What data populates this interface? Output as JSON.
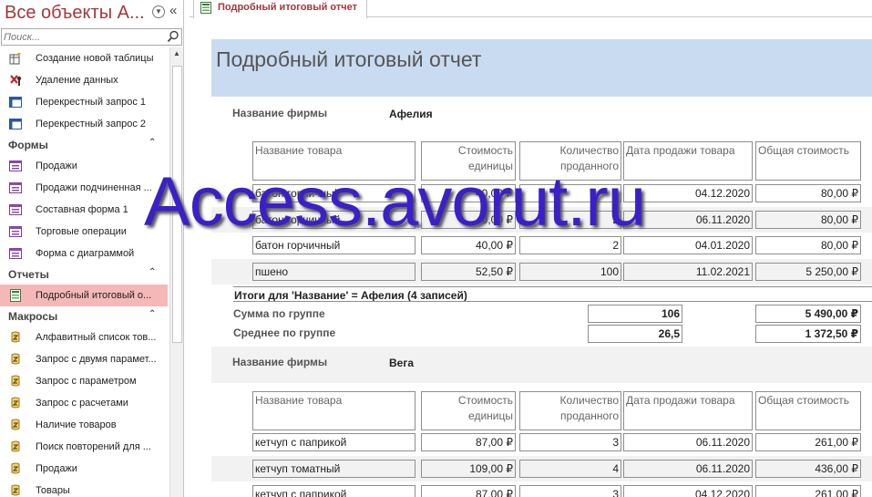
{
  "nav": {
    "title": "Все объекты A...",
    "search_placeholder": "Поиск...",
    "items": [
      {
        "kind": "item",
        "icon": "create-table-query-icon",
        "label": "Создание новой таблицы"
      },
      {
        "kind": "item",
        "icon": "delete-query-icon",
        "label": "Удаление данных"
      },
      {
        "kind": "item",
        "icon": "crosstab-query-icon",
        "label": "Перекрестный запрос 1"
      },
      {
        "kind": "item",
        "icon": "crosstab-query-icon",
        "label": "Перекрестный запрос 2"
      },
      {
        "kind": "group",
        "label": "Формы"
      },
      {
        "kind": "item",
        "icon": "form-icon",
        "label": "Продажи"
      },
      {
        "kind": "item",
        "icon": "form-icon",
        "label": "Продажи подчиненная ..."
      },
      {
        "kind": "item",
        "icon": "form-icon",
        "label": "Составная форма 1"
      },
      {
        "kind": "item",
        "icon": "form-icon",
        "label": "Торговые операции"
      },
      {
        "kind": "item",
        "icon": "form-icon",
        "label": "Форма с диаграммой"
      },
      {
        "kind": "group",
        "label": "Отчеты"
      },
      {
        "kind": "item",
        "icon": "report-icon",
        "label": "Подробный итоговый о...",
        "selected": true
      },
      {
        "kind": "group",
        "label": "Макросы"
      },
      {
        "kind": "item",
        "icon": "macro-icon",
        "label": "Алфавитный список тов..."
      },
      {
        "kind": "item",
        "icon": "macro-icon",
        "label": "Запрос с двумя парамет..."
      },
      {
        "kind": "item",
        "icon": "macro-icon",
        "label": "Запрос с параметром"
      },
      {
        "kind": "item",
        "icon": "macro-icon",
        "label": "Запрос с расчетами"
      },
      {
        "kind": "item",
        "icon": "macro-icon",
        "label": "Наличие товаров"
      },
      {
        "kind": "item",
        "icon": "macro-icon",
        "label": "Поиск повторений для ..."
      },
      {
        "kind": "item",
        "icon": "macro-icon",
        "label": "Продажи"
      },
      {
        "kind": "item",
        "icon": "macro-icon",
        "label": "Товары"
      }
    ]
  },
  "tab": {
    "label": "Подробный итоговый отчет"
  },
  "report": {
    "title": "Подробный итоговый отчет",
    "group_label": "Название фирмы",
    "columns": [
      "Название товара",
      "Стоимость единицы",
      "Количество проданного",
      "Дата продажи товара",
      "Общая стоимость"
    ],
    "groups": [
      {
        "name": "Афелия",
        "rows": [
          [
            "батон горчичный",
            "40,00 ₽",
            "2",
            "04.12.2020",
            "80,00 ₽"
          ],
          [
            "батон горчичный",
            "40,00 ₽",
            "2",
            "06.11.2020",
            "80,00 ₽"
          ],
          [
            "батон горчичный",
            "40,00 ₽",
            "2",
            "04.01.2020",
            "80,00 ₽"
          ],
          [
            "пшено",
            "52,50 ₽",
            "100",
            "11.02.2021",
            "5 250,00 ₽"
          ]
        ],
        "summary_title": "Итоги для 'Название' =  Афелия (4 записей)",
        "sum_label": "Сумма по группе",
        "avg_label": "Среднее по группе",
        "sum_qty": "106",
        "sum_total": "5 490,00 ₽",
        "avg_qty": "26,5",
        "avg_total": "1 372,50 ₽"
      },
      {
        "name": "Вега",
        "rows": [
          [
            "кетчуп с паприкой",
            "87,00 ₽",
            "3",
            "06.11.2020",
            "261,00 ₽"
          ],
          [
            "кетчуп томатный",
            "109,00 ₽",
            "4",
            "06.11.2020",
            "436,00 ₽"
          ],
          [
            "кетчуп с паприкой",
            "87,00 ₽",
            "3",
            "04.12.2020",
            "261,00 ₽"
          ]
        ]
      }
    ]
  },
  "watermark": "Access.avorut.ru",
  "colors": {
    "accent": "#a4373a",
    "report_header_bg": "#c9dbf1",
    "selected_item_bg": "#f5b8b8",
    "watermark": "#3a20c8"
  }
}
